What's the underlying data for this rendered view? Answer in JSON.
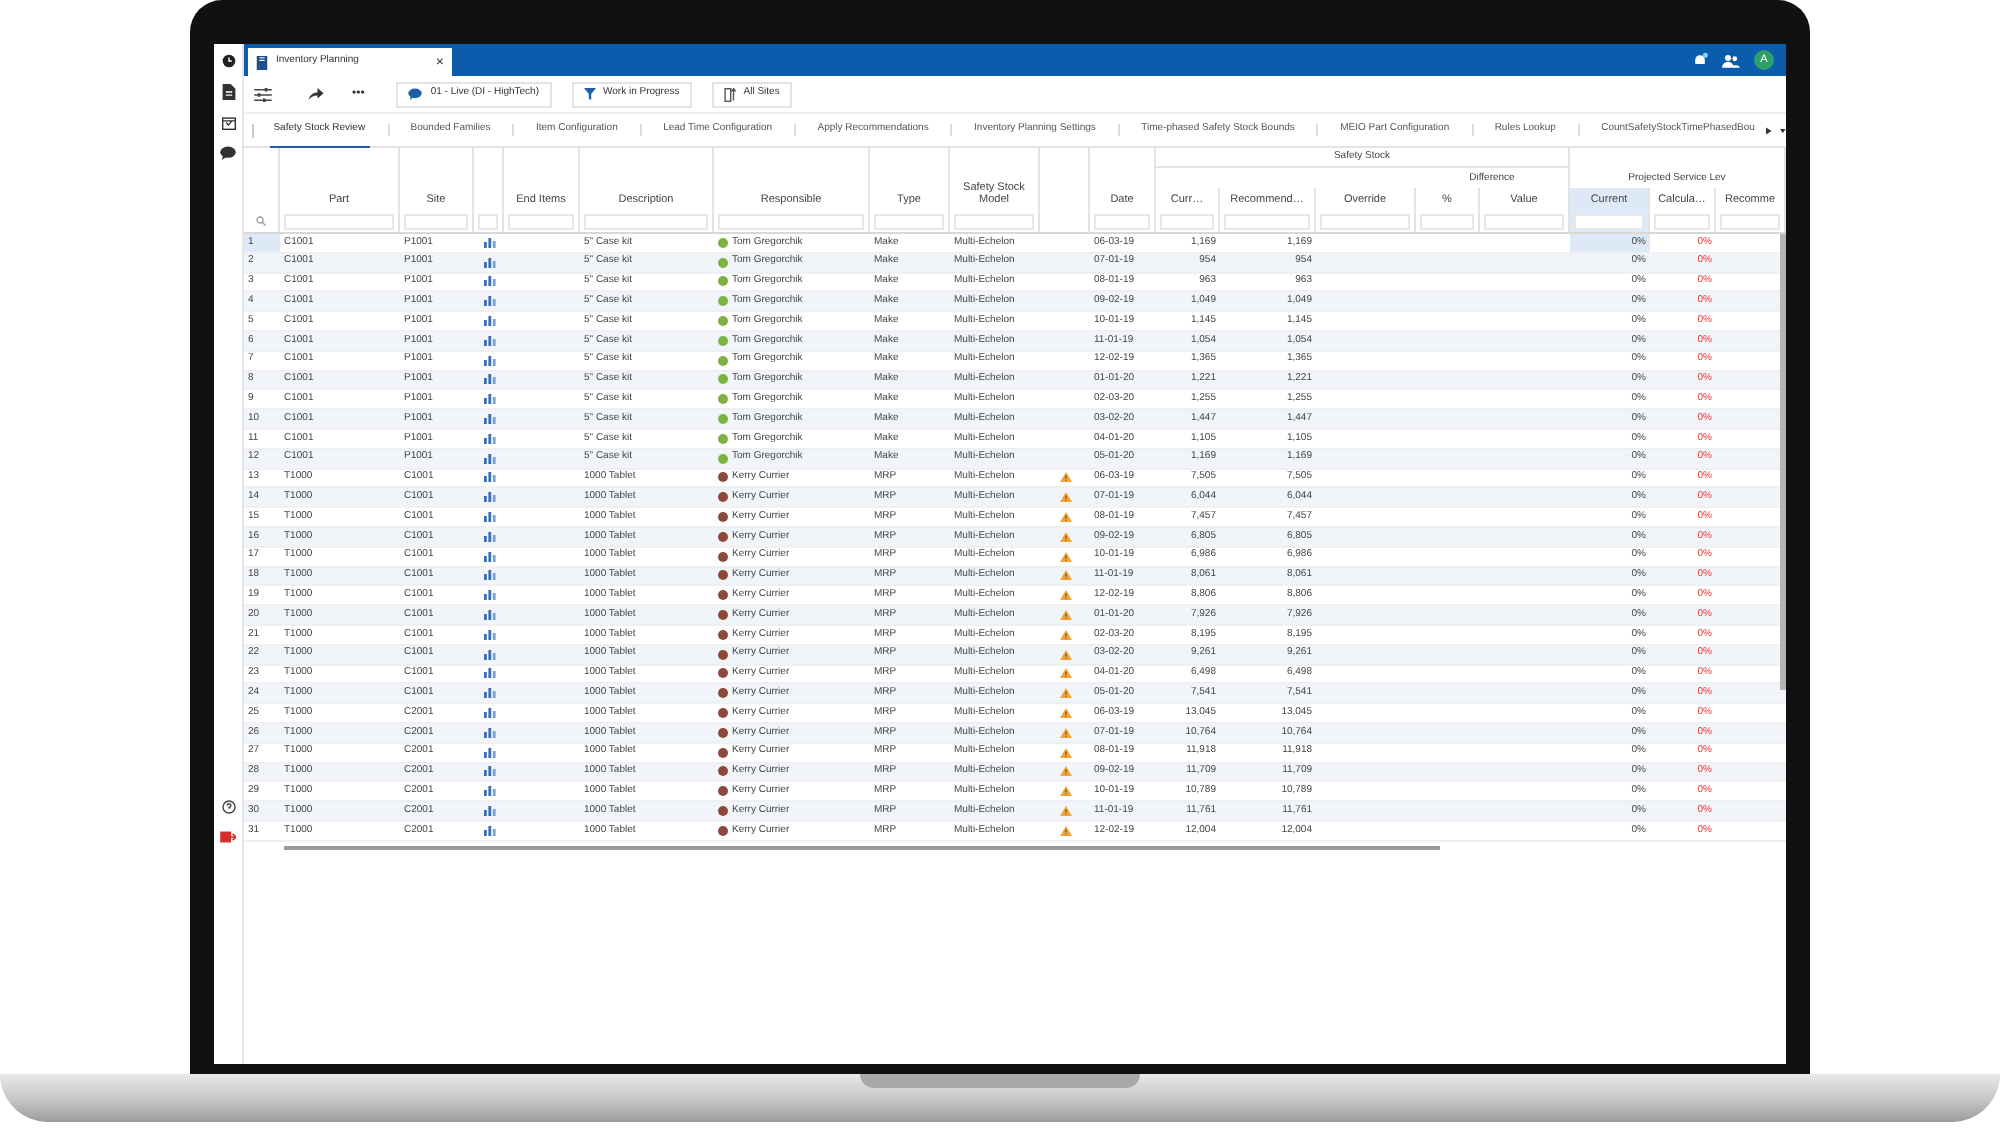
{
  "window_tab": {
    "title": "Inventory Planning",
    "close": "×"
  },
  "avatar": "A",
  "toolbar": {
    "more": "•••",
    "buttons": [
      {
        "kind": "chat",
        "label": "01 - Live (DI - HighTech)"
      },
      {
        "kind": "filter",
        "label": "Work in Progress"
      },
      {
        "kind": "sites",
        "label": "All Sites"
      }
    ]
  },
  "tabs": [
    {
      "label": "Safety Stock Review",
      "selected": true
    },
    {
      "label": "Bounded Families",
      "selected": false
    },
    {
      "label": "Item Configuration",
      "selected": false
    },
    {
      "label": "Lead Time Configuration",
      "selected": false
    },
    {
      "label": "Apply Recommendations",
      "selected": false
    },
    {
      "label": "Inventory Planning Settings",
      "selected": false
    },
    {
      "label": "Time-phased Safety Stock Bounds",
      "selected": false
    },
    {
      "label": "MEIO Part Configuration",
      "selected": false
    },
    {
      "label": "Rules Lookup",
      "selected": false
    },
    {
      "label": "CountSafetyStockTimePhasedBou",
      "selected": false
    }
  ],
  "table": {
    "columns": [
      {
        "label": "Part",
        "selected": false
      },
      {
        "label": "Site",
        "selected": false
      },
      {
        "label": "End Items",
        "selected": false
      },
      {
        "label": "Description",
        "selected": false
      },
      {
        "label": "Responsible",
        "selected": false
      },
      {
        "label": "Type",
        "selected": false
      },
      {
        "label": "Safety Stock Model",
        "selected": false
      },
      {
        "label": "Date",
        "selected": false
      },
      {
        "label": "Safety Stock",
        "children": [
          {
            "label": "Curr…",
            "selected": false
          },
          {
            "label": "Recommend…",
            "selected": false
          },
          {
            "label": "Override",
            "selected": false
          },
          {
            "label": "Difference",
            "children": [
              {
                "label": "%",
                "selected": false
              },
              {
                "label": "Value",
                "selected": false
              }
            ]
          }
        ]
      },
      {
        "label": "Projected Service Lev",
        "children": [
          {
            "label": "Current",
            "selected": true
          },
          {
            "label": "Calcula…",
            "selected": false
          },
          {
            "label": "Recomme",
            "selected": false
          }
        ]
      }
    ],
    "rows": [
      {
        "n": "1",
        "part": "C1001",
        "site": "P1001",
        "description": "5\" Case kit",
        "responsible": "Tom Gregorchik",
        "color": "#7cb342",
        "type": "Make",
        "model": "Multi-Echelon",
        "warning": false,
        "date": "06-03-19",
        "current_ss": "1,169",
        "recommended": "1,169",
        "current_psl": "0%",
        "calculated": "0%",
        "selected": true
      },
      {
        "n": "2",
        "part": "C1001",
        "site": "P1001",
        "description": "5\" Case kit",
        "responsible": "Tom Gregorchik",
        "color": "#7cb342",
        "type": "Make",
        "model": "Multi-Echelon",
        "warning": false,
        "date": "07-01-19",
        "current_ss": "954",
        "recommended": "954",
        "current_psl": "0%",
        "calculated": "0%",
        "selected": false
      },
      {
        "n": "3",
        "part": "C1001",
        "site": "P1001",
        "description": "5\" Case kit",
        "responsible": "Tom Gregorchik",
        "color": "#7cb342",
        "type": "Make",
        "model": "Multi-Echelon",
        "warning": false,
        "date": "08-01-19",
        "current_ss": "963",
        "recommended": "963",
        "current_psl": "0%",
        "calculated": "0%",
        "selected": false
      },
      {
        "n": "4",
        "part": "C1001",
        "site": "P1001",
        "description": "5\" Case kit",
        "responsible": "Tom Gregorchik",
        "color": "#7cb342",
        "type": "Make",
        "model": "Multi-Echelon",
        "warning": false,
        "date": "09-02-19",
        "current_ss": "1,049",
        "recommended": "1,049",
        "current_psl": "0%",
        "calculated": "0%",
        "selected": false
      },
      {
        "n": "5",
        "part": "C1001",
        "site": "P1001",
        "description": "5\" Case kit",
        "responsible": "Tom Gregorchik",
        "color": "#7cb342",
        "type": "Make",
        "model": "Multi-Echelon",
        "warning": false,
        "date": "10-01-19",
        "current_ss": "1,145",
        "recommended": "1,145",
        "current_psl": "0%",
        "calculated": "0%",
        "selected": false
      },
      {
        "n": "6",
        "part": "C1001",
        "site": "P1001",
        "description": "5\" Case kit",
        "responsible": "Tom Gregorchik",
        "color": "#7cb342",
        "type": "Make",
        "model": "Multi-Echelon",
        "warning": false,
        "date": "11-01-19",
        "current_ss": "1,054",
        "recommended": "1,054",
        "current_psl": "0%",
        "calculated": "0%",
        "selected": false
      },
      {
        "n": "7",
        "part": "C1001",
        "site": "P1001",
        "description": "5\" Case kit",
        "responsible": "Tom Gregorchik",
        "color": "#7cb342",
        "type": "Make",
        "model": "Multi-Echelon",
        "warning": false,
        "date": "12-02-19",
        "current_ss": "1,365",
        "recommended": "1,365",
        "current_psl": "0%",
        "calculated": "0%",
        "selected": false
      },
      {
        "n": "8",
        "part": "C1001",
        "site": "P1001",
        "description": "5\" Case kit",
        "responsible": "Tom Gregorchik",
        "color": "#7cb342",
        "type": "Make",
        "model": "Multi-Echelon",
        "warning": false,
        "date": "01-01-20",
        "current_ss": "1,221",
        "recommended": "1,221",
        "current_psl": "0%",
        "calculated": "0%",
        "selected": false
      },
      {
        "n": "9",
        "part": "C1001",
        "site": "P1001",
        "description": "5\" Case kit",
        "responsible": "Tom Gregorchik",
        "color": "#7cb342",
        "type": "Make",
        "model": "Multi-Echelon",
        "warning": false,
        "date": "02-03-20",
        "current_ss": "1,255",
        "recommended": "1,255",
        "current_psl": "0%",
        "calculated": "0%",
        "selected": false
      },
      {
        "n": "10",
        "part": "C1001",
        "site": "P1001",
        "description": "5\" Case kit",
        "responsible": "Tom Gregorchik",
        "color": "#7cb342",
        "type": "Make",
        "model": "Multi-Echelon",
        "warning": false,
        "date": "03-02-20",
        "current_ss": "1,447",
        "recommended": "1,447",
        "current_psl": "0%",
        "calculated": "0%",
        "selected": false
      },
      {
        "n": "11",
        "part": "C1001",
        "site": "P1001",
        "description": "5\" Case kit",
        "responsible": "Tom Gregorchik",
        "color": "#7cb342",
        "type": "Make",
        "model": "Multi-Echelon",
        "warning": false,
        "date": "04-01-20",
        "current_ss": "1,105",
        "recommended": "1,105",
        "current_psl": "0%",
        "calculated": "0%",
        "selected": false
      },
      {
        "n": "12",
        "part": "C1001",
        "site": "P1001",
        "description": "5\" Case kit",
        "responsible": "Tom Gregorchik",
        "color": "#7cb342",
        "type": "Make",
        "model": "Multi-Echelon",
        "warning": false,
        "date": "05-01-20",
        "current_ss": "1,169",
        "recommended": "1,169",
        "current_psl": "0%",
        "calculated": "0%",
        "selected": false
      },
      {
        "n": "13",
        "part": "T1000",
        "site": "C1001",
        "description": "1000 Tablet",
        "responsible": "Kerry Currier",
        "color": "#8d4a3a",
        "type": "MRP",
        "model": "Multi-Echelon",
        "warning": true,
        "date": "06-03-19",
        "current_ss": "7,505",
        "recommended": "7,505",
        "current_psl": "0%",
        "calculated": "0%",
        "selected": false
      },
      {
        "n": "14",
        "part": "T1000",
        "site": "C1001",
        "description": "1000 Tablet",
        "responsible": "Kerry Currier",
        "color": "#8d4a3a",
        "type": "MRP",
        "model": "Multi-Echelon",
        "warning": true,
        "date": "07-01-19",
        "current_ss": "6,044",
        "recommended": "6,044",
        "current_psl": "0%",
        "calculated": "0%",
        "selected": false
      },
      {
        "n": "15",
        "part": "T1000",
        "site": "C1001",
        "description": "1000 Tablet",
        "responsible": "Kerry Currier",
        "color": "#8d4a3a",
        "type": "MRP",
        "model": "Multi-Echelon",
        "warning": true,
        "date": "08-01-19",
        "current_ss": "7,457",
        "recommended": "7,457",
        "current_psl": "0%",
        "calculated": "0%",
        "selected": false
      },
      {
        "n": "16",
        "part": "T1000",
        "site": "C1001",
        "description": "1000 Tablet",
        "responsible": "Kerry Currier",
        "color": "#8d4a3a",
        "type": "MRP",
        "model": "Multi-Echelon",
        "warning": true,
        "date": "09-02-19",
        "current_ss": "6,805",
        "recommended": "6,805",
        "current_psl": "0%",
        "calculated": "0%",
        "selected": false
      },
      {
        "n": "17",
        "part": "T1000",
        "site": "C1001",
        "description": "1000 Tablet",
        "responsible": "Kerry Currier",
        "color": "#8d4a3a",
        "type": "MRP",
        "model": "Multi-Echelon",
        "warning": true,
        "date": "10-01-19",
        "current_ss": "6,986",
        "recommended": "6,986",
        "current_psl": "0%",
        "calculated": "0%",
        "selected": false
      },
      {
        "n": "18",
        "part": "T1000",
        "site": "C1001",
        "description": "1000 Tablet",
        "responsible": "Kerry Currier",
        "color": "#8d4a3a",
        "type": "MRP",
        "model": "Multi-Echelon",
        "warning": true,
        "date": "11-01-19",
        "current_ss": "8,061",
        "recommended": "8,061",
        "current_psl": "0%",
        "calculated": "0%",
        "selected": false
      },
      {
        "n": "19",
        "part": "T1000",
        "site": "C1001",
        "description": "1000 Tablet",
        "responsible": "Kerry Currier",
        "color": "#8d4a3a",
        "type": "MRP",
        "model": "Multi-Echelon",
        "warning": true,
        "date": "12-02-19",
        "current_ss": "8,806",
        "recommended": "8,806",
        "current_psl": "0%",
        "calculated": "0%",
        "selected": false
      },
      {
        "n": "20",
        "part": "T1000",
        "site": "C1001",
        "description": "1000 Tablet",
        "responsible": "Kerry Currier",
        "color": "#8d4a3a",
        "type": "MRP",
        "model": "Multi-Echelon",
        "warning": true,
        "date": "01-01-20",
        "current_ss": "7,926",
        "recommended": "7,926",
        "current_psl": "0%",
        "calculated": "0%",
        "selected": false
      },
      {
        "n": "21",
        "part": "T1000",
        "site": "C1001",
        "description": "1000 Tablet",
        "responsible": "Kerry Currier",
        "color": "#8d4a3a",
        "type": "MRP",
        "model": "Multi-Echelon",
        "warning": true,
        "date": "02-03-20",
        "current_ss": "8,195",
        "recommended": "8,195",
        "current_psl": "0%",
        "calculated": "0%",
        "selected": false
      },
      {
        "n": "22",
        "part": "T1000",
        "site": "C1001",
        "description": "1000 Tablet",
        "responsible": "Kerry Currier",
        "color": "#8d4a3a",
        "type": "MRP",
        "model": "Multi-Echelon",
        "warning": true,
        "date": "03-02-20",
        "current_ss": "9,261",
        "recommended": "9,261",
        "current_psl": "0%",
        "calculated": "0%",
        "selected": false
      },
      {
        "n": "23",
        "part": "T1000",
        "site": "C1001",
        "description": "1000 Tablet",
        "responsible": "Kerry Currier",
        "color": "#8d4a3a",
        "type": "MRP",
        "model": "Multi-Echelon",
        "warning": true,
        "date": "04-01-20",
        "current_ss": "6,498",
        "recommended": "6,498",
        "current_psl": "0%",
        "calculated": "0%",
        "selected": false
      },
      {
        "n": "24",
        "part": "T1000",
        "site": "C1001",
        "description": "1000 Tablet",
        "responsible": "Kerry Currier",
        "color": "#8d4a3a",
        "type": "MRP",
        "model": "Multi-Echelon",
        "warning": true,
        "date": "05-01-20",
        "current_ss": "7,541",
        "recommended": "7,541",
        "current_psl": "0%",
        "calculated": "0%",
        "selected": false
      },
      {
        "n": "25",
        "part": "T1000",
        "site": "C2001",
        "description": "1000 Tablet",
        "responsible": "Kerry Currier",
        "color": "#8d4a3a",
        "type": "MRP",
        "model": "Multi-Echelon",
        "warning": true,
        "date": "06-03-19",
        "current_ss": "13,045",
        "recommended": "13,045",
        "current_psl": "0%",
        "calculated": "0%",
        "selected": false
      },
      {
        "n": "26",
        "part": "T1000",
        "site": "C2001",
        "description": "1000 Tablet",
        "responsible": "Kerry Currier",
        "color": "#8d4a3a",
        "type": "MRP",
        "model": "Multi-Echelon",
        "warning": true,
        "date": "07-01-19",
        "current_ss": "10,764",
        "recommended": "10,764",
        "current_psl": "0%",
        "calculated": "0%",
        "selected": false
      },
      {
        "n": "27",
        "part": "T1000",
        "site": "C2001",
        "description": "1000 Tablet",
        "responsible": "Kerry Currier",
        "color": "#8d4a3a",
        "type": "MRP",
        "model": "Multi-Echelon",
        "warning": true,
        "date": "08-01-19",
        "current_ss": "11,918",
        "recommended": "11,918",
        "current_psl": "0%",
        "calculated": "0%",
        "selected": false
      },
      {
        "n": "28",
        "part": "T1000",
        "site": "C2001",
        "description": "1000 Tablet",
        "responsible": "Kerry Currier",
        "color": "#8d4a3a",
        "type": "MRP",
        "model": "Multi-Echelon",
        "warning": true,
        "date": "09-02-19",
        "current_ss": "11,709",
        "recommended": "11,709",
        "current_psl": "0%",
        "calculated": "0%",
        "selected": false
      },
      {
        "n": "29",
        "part": "T1000",
        "site": "C2001",
        "description": "1000 Tablet",
        "responsible": "Kerry Currier",
        "color": "#8d4a3a",
        "type": "MRP",
        "model": "Multi-Echelon",
        "warning": true,
        "date": "10-01-19",
        "current_ss": "10,789",
        "recommended": "10,789",
        "current_psl": "0%",
        "calculated": "0%",
        "selected": false
      },
      {
        "n": "30",
        "part": "T1000",
        "site": "C2001",
        "description": "1000 Tablet",
        "responsible": "Kerry Currier",
        "color": "#8d4a3a",
        "type": "MRP",
        "model": "Multi-Echelon",
        "warning": true,
        "date": "11-01-19",
        "current_ss": "11,761",
        "recommended": "11,761",
        "current_psl": "0%",
        "calculated": "0%",
        "selected": false
      },
      {
        "n": "31",
        "part": "T1000",
        "site": "C2001",
        "description": "1000 Tablet",
        "responsible": "Kerry Currier",
        "color": "#8d4a3a",
        "type": "MRP",
        "model": "Multi-Echelon",
        "warning": true,
        "date": "12-02-19",
        "current_ss": "12,004",
        "recommended": "12,004",
        "current_psl": "0%",
        "calculated": "0%",
        "selected": false
      }
    ]
  }
}
